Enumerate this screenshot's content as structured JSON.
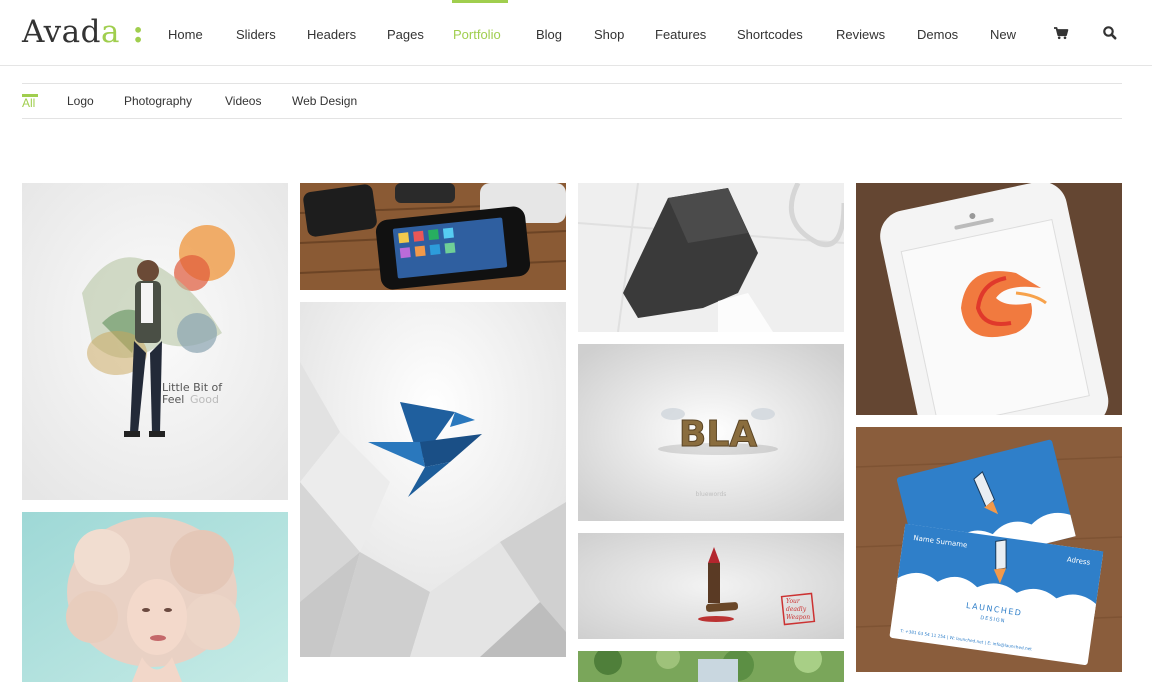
{
  "brand": {
    "logo_main": "Avad",
    "logo_accent": "a",
    "logo_colon": ":"
  },
  "nav": {
    "items": [
      "Home",
      "Sliders",
      "Headers",
      "Pages",
      "Portfolio",
      "Blog",
      "Shop",
      "Features",
      "Shortcodes",
      "Reviews",
      "Demos",
      "New"
    ],
    "active": "Portfolio",
    "icons": [
      "cart-icon",
      "search-icon"
    ]
  },
  "filters": {
    "items": [
      "All",
      "Logo",
      "Photography",
      "Videos",
      "Web Design"
    ],
    "active": "All"
  },
  "portfolio": {
    "items": [
      {
        "caption_line1": "Little Bit of",
        "caption_line2_a": "Feel",
        "caption_line2_b": "Good"
      },
      {
        "word": "BLA",
        "small": "bluewords"
      },
      {
        "stamp_line1": "Your",
        "stamp_line2": "deadly",
        "stamp_line3": "Weapon"
      },
      {
        "card_name": "Name Surname",
        "card_address": "Adress",
        "card_brand": "LAUNCHED",
        "card_sub": "DESIGN",
        "card_footer": "T: +381 63 54 11 254  |  W: launched.net  |  E: info@launched.net"
      }
    ]
  },
  "colors": {
    "accent": "#a0ce4e",
    "text": "#333333",
    "border": "#e5e5e5"
  }
}
